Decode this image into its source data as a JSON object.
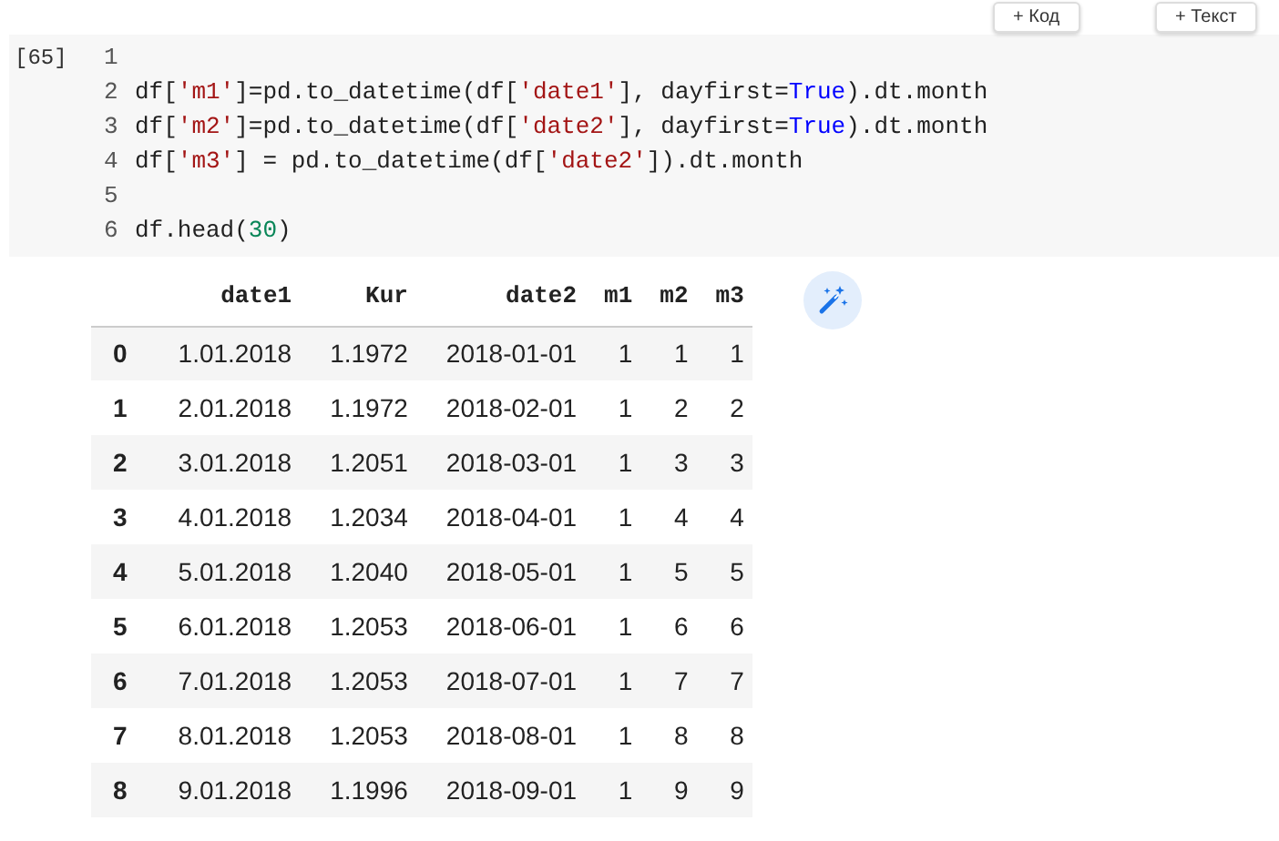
{
  "toolbar": {
    "buttons": [
      {
        "icon": "+",
        "label": "Код"
      },
      {
        "icon": "+",
        "label": "Текст"
      }
    ]
  },
  "code_cell": {
    "execution_count": "[65]",
    "lines": [
      {
        "number": "1"
      },
      {
        "number": "2",
        "tokens": [
          {
            "kind": "plain",
            "text": "df["
          },
          {
            "kind": "string",
            "text": "'m1'"
          },
          {
            "kind": "plain",
            "text": "]=pd.to_datetime(df["
          },
          {
            "kind": "string",
            "text": "'date1'"
          },
          {
            "kind": "plain",
            "text": "], dayfirst="
          },
          {
            "kind": "keyword",
            "text": "True"
          },
          {
            "kind": "plain",
            "text": ").dt.month"
          }
        ]
      },
      {
        "number": "3",
        "tokens": [
          {
            "kind": "plain",
            "text": "df["
          },
          {
            "kind": "string",
            "text": "'m2'"
          },
          {
            "kind": "plain",
            "text": "]=pd.to_datetime(df["
          },
          {
            "kind": "string",
            "text": "'date2'"
          },
          {
            "kind": "plain",
            "text": "], dayfirst="
          },
          {
            "kind": "keyword",
            "text": "True"
          },
          {
            "kind": "plain",
            "text": ").dt.month"
          }
        ]
      },
      {
        "number": "4",
        "tokens": [
          {
            "kind": "plain",
            "text": "df["
          },
          {
            "kind": "string",
            "text": "'m3'"
          },
          {
            "kind": "plain",
            "text": "] = pd.to_datetime(df["
          },
          {
            "kind": "string",
            "text": "'date2'"
          },
          {
            "kind": "plain",
            "text": "]).dt.month"
          }
        ]
      },
      {
        "number": "5"
      },
      {
        "number": "6",
        "tokens": [
          {
            "kind": "plain",
            "text": "df.head("
          },
          {
            "kind": "number",
            "text": "30"
          },
          {
            "kind": "plain",
            "text": ")"
          }
        ]
      }
    ]
  },
  "output_table": {
    "columns": [
      "date1",
      "Kur",
      "date2",
      "m1",
      "m2",
      "m3"
    ],
    "rows": [
      {
        "index": "0",
        "cells": [
          "1.01.2018",
          "1.1972",
          "2018-01-01",
          "1",
          "1",
          "1"
        ]
      },
      {
        "index": "1",
        "cells": [
          "2.01.2018",
          "1.1972",
          "2018-02-01",
          "1",
          "2",
          "2"
        ]
      },
      {
        "index": "2",
        "cells": [
          "3.01.2018",
          "1.2051",
          "2018-03-01",
          "1",
          "3",
          "3"
        ]
      },
      {
        "index": "3",
        "cells": [
          "4.01.2018",
          "1.2034",
          "2018-04-01",
          "1",
          "4",
          "4"
        ]
      },
      {
        "index": "4",
        "cells": [
          "5.01.2018",
          "1.2040",
          "2018-05-01",
          "1",
          "5",
          "5"
        ]
      },
      {
        "index": "5",
        "cells": [
          "6.01.2018",
          "1.2053",
          "2018-06-01",
          "1",
          "6",
          "6"
        ]
      },
      {
        "index": "6",
        "cells": [
          "7.01.2018",
          "1.2053",
          "2018-07-01",
          "1",
          "7",
          "7"
        ]
      },
      {
        "index": "7",
        "cells": [
          "8.01.2018",
          "1.2053",
          "2018-08-01",
          "1",
          "8",
          "8"
        ]
      },
      {
        "index": "8",
        "cells": [
          "9.01.2018",
          "1.1996",
          "2018-09-01",
          "1",
          "9",
          "9"
        ]
      }
    ]
  }
}
